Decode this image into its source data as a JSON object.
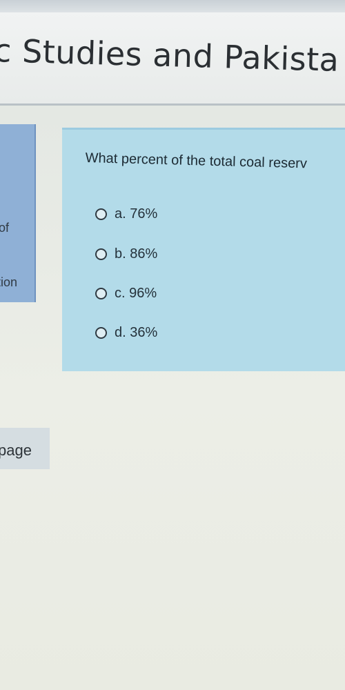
{
  "header": {
    "course_title": "c Studies and Pakista"
  },
  "info_panel": {
    "line1": "of",
    "line2": "tion"
  },
  "question": {
    "text": "What percent of the total coal reserv",
    "options": [
      {
        "label": "a. 76%"
      },
      {
        "label": "b. 86%"
      },
      {
        "label": "c. 96%"
      },
      {
        "label": "d. 36%"
      }
    ]
  },
  "navigation": {
    "page_label": "page"
  }
}
